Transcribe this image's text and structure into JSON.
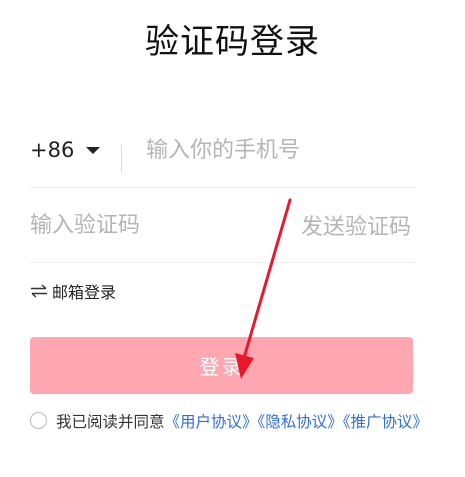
{
  "page": {
    "title": "验证码登录"
  },
  "phone": {
    "country_code": "+86",
    "placeholder": "输入你的手机号"
  },
  "code": {
    "placeholder": "输入验证码",
    "send_label": "发送验证码"
  },
  "switch": {
    "icon": "swap-arrows-icon",
    "label": "邮箱登录"
  },
  "login": {
    "label": "登录"
  },
  "agreement": {
    "text": "我已阅读并同意",
    "link_user": "《用户协议》",
    "link_privacy": "《隐私协议》",
    "link_promo": "《推广协议》"
  },
  "colors": {
    "button_bg": "#fea7b0",
    "link": "#2f6ee0",
    "annotation_arrow": "#e8192c"
  }
}
